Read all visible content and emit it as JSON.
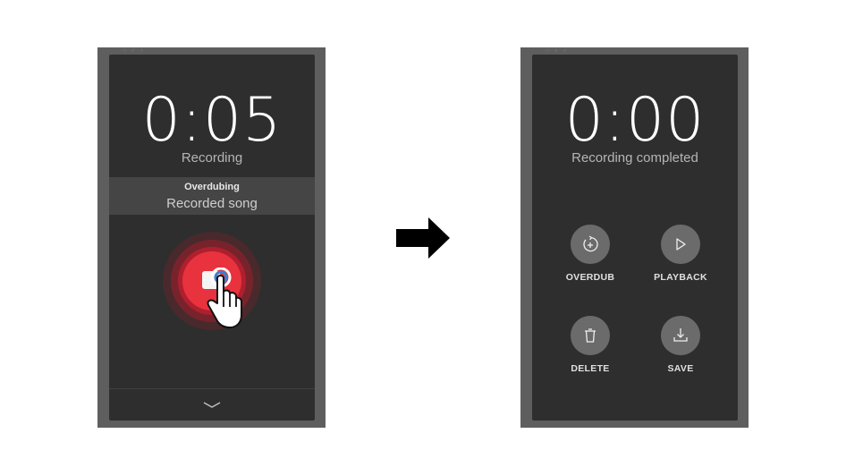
{
  "left_screen": {
    "timer": "0:05",
    "status": "Recording",
    "overdub_title": "Overdubing",
    "overdub_song": "Recorded song",
    "stop_icon": "stop-icon",
    "colors": {
      "record_red": "#e8323e",
      "panel": "#2e2e2e"
    }
  },
  "transition_icon": "right-arrow-icon",
  "right_screen": {
    "timer": "0:00",
    "status": "Recording completed",
    "actions": [
      {
        "label": "OVERDUB",
        "icon": "overdub-icon"
      },
      {
        "label": "PLAYBACK",
        "icon": "play-icon"
      },
      {
        "label": "DELETE",
        "icon": "trash-icon"
      },
      {
        "label": "SAVE",
        "icon": "download-icon"
      }
    ]
  }
}
